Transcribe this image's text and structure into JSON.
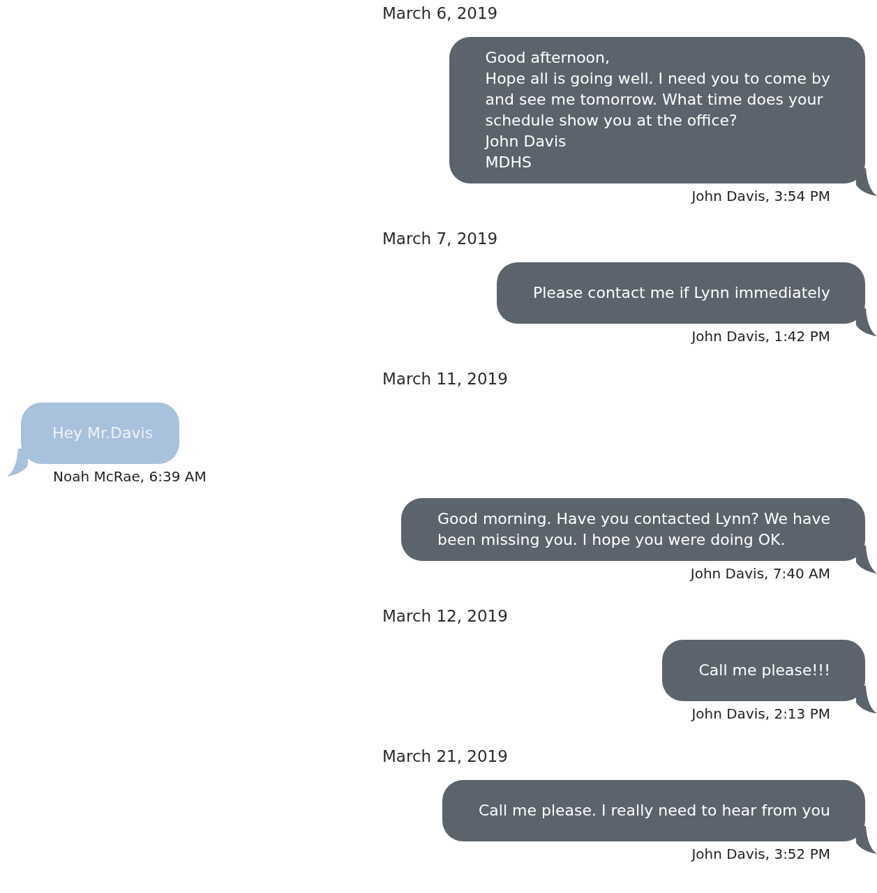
{
  "thread": [
    {
      "kind": "date",
      "text": "March 6, 2019"
    },
    {
      "kind": "outgoing",
      "text": "Good afternoon,\nHope all is going well. I need you to come by\nand see me tomorrow. What time does your\nschedule show you at the office?\nJohn Davis\nMDHS",
      "caption": "John Davis, 3:54 PM"
    },
    {
      "kind": "date",
      "text": "March 7, 2019"
    },
    {
      "kind": "outgoing",
      "text": "Please contact me if Lynn immediately",
      "caption": "John Davis, 1:42 PM"
    },
    {
      "kind": "date",
      "text": "March 11, 2019"
    },
    {
      "kind": "incoming",
      "text": "Hey Mr.Davis",
      "caption": "Noah McRae, 6:39 AM"
    },
    {
      "kind": "outgoing",
      "text": "Good morning. Have you contacted Lynn? We have\nbeen missing you. I hope you were doing OK.",
      "caption": "John Davis, 7:40 AM"
    },
    {
      "kind": "date",
      "text": "March 12, 2019"
    },
    {
      "kind": "outgoing",
      "text": "Call me please!!!",
      "caption": "John Davis, 2:13 PM"
    },
    {
      "kind": "date",
      "text": "March 21, 2019"
    },
    {
      "kind": "outgoing",
      "text": "Call me please. I really need to hear from you",
      "caption": "John Davis, 3:52 PM"
    }
  ]
}
